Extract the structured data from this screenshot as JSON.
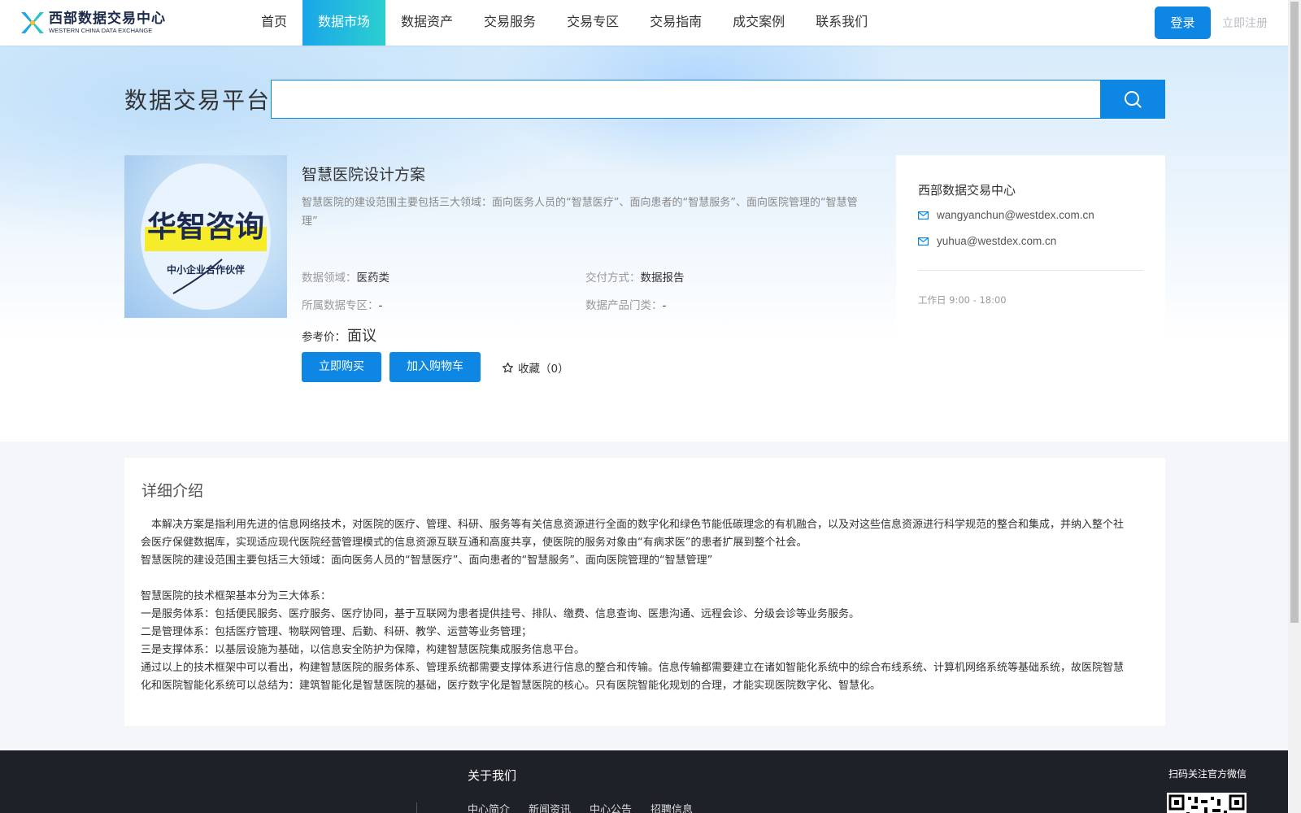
{
  "header": {
    "logo_cn": "西部数据交易中心",
    "logo_en": "WESTERN CHINA DATA EXCHANGE",
    "nav": [
      "首页",
      "数据市场",
      "数据资产",
      "交易服务",
      "交易专区",
      "交易指南",
      "成交案例",
      "联系我们"
    ],
    "active_nav": "数据市场",
    "login": "登录",
    "register": "立即注册"
  },
  "search": {
    "platform_title": "数据交易平台",
    "placeholder": ""
  },
  "product": {
    "image_text_main": "华智咨询",
    "image_text_sub": "中小企业合作伙伴",
    "title": "智慧医院设计方案",
    "description": "智慧医院的建设范围主要包括三大领域：面向医务人员的“智慧医疗”、面向患者的“智慧服务”、面向医院管理的“智慧管理”",
    "meta": {
      "domain_label": "数据领域：",
      "domain_value": "医药类",
      "delivery_label": "交付方式：",
      "delivery_value": "数据报告",
      "zone_label": "所属数据专区：",
      "zone_value": "-",
      "category_label": "数据产品门类：",
      "category_value": "-"
    },
    "price_label": "参考价：",
    "price_value": "面议",
    "buy_label": "立即购买",
    "cart_label": "加入购物车",
    "favorite_label": "收藏（0）"
  },
  "contact": {
    "name": "西部数据交易中心",
    "emails": [
      "wangyanchun@westdex.com.cn",
      "yuhua@westdex.com.cn"
    ],
    "work_hours": "工作日 9:00 - 18:00"
  },
  "details": {
    "title": "详细介绍",
    "paragraphs": [
      "　本解决方案是指利用先进的信息网络技术，对医院的医疗、管理、科研、服务等有关信息资源进行全面的数字化和绿色节能低碳理念的有机融合，以及对这些信息资源进行科学规范的整合和集成，并纳入整个社会医疗保健数据库，实现适应现代医院经营管理模式的信息资源互联互通和高度共享，使医院的服务对象由“有病求医”的患者扩展到整个社会。",
      "智慧医院的建设范围主要包括三大领域：面向医务人员的“智慧医疗”、面向患者的“智慧服务”、面向医院管理的“智慧管理”",
      "",
      "智慧医院的技术框架基本分为三大体系：",
      "一是服务体系：包括便民服务、医疗服务、医疗协同，基于互联网为患者提供挂号、排队、缴费、信息查询、医患沟通、远程会诊、分级会诊等业务服务。",
      "二是管理体系：包括医疗管理、物联网管理、后勤、科研、教学、运营等业务管理；",
      "三是支撑体系：以基层设施为基础，以信息安全防护为保障，构建智慧医院集成服务信息平台。",
      "通过以上的技术框架中可以看出，构建智慧医院的服务体系、管理系统都需要支撑体系进行信息的整合和传输。信息传输都需要建立在诸如智能化系统中的综合布线系统、计算机网络系统等基础系统，故医院智慧化和医院智能化系统可以总结为：建筑智能化是智慧医院的基础，医疗数字化是智慧医院的核心。只有医院智能化规划的合理，才能实现医院数字化、智慧化。"
    ]
  },
  "footer": {
    "about_title": "关于我们",
    "links": [
      "中心简介",
      "新闻资讯",
      "中心公告",
      "招聘信息"
    ],
    "qr_label": "扫码关注官方微信"
  },
  "colors": {
    "primary": "#0d87e3",
    "nav_active_start": "#19a6e9",
    "nav_active_end": "#2ccfd0",
    "footer_bg": "#1f2129"
  }
}
